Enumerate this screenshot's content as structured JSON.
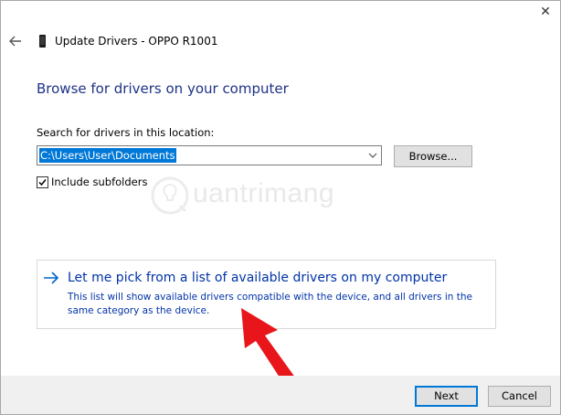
{
  "window": {
    "title": "Update Drivers - OPPO R1001",
    "close_glyph": "✕",
    "back_icon": "back-arrow-icon",
    "device_icon": "phone-icon"
  },
  "page": {
    "heading": "Browse for drivers on your computer",
    "search_label": "Search for drivers in this location:",
    "path_value": "C:\\Users\\User\\Documents",
    "browse_label": "Browse...",
    "include_subfolders_label": "Include subfolders",
    "include_subfolders_checked": true
  },
  "pick_option": {
    "title": "Let me pick from a list of available drivers on my computer",
    "description": "This list will show available drivers compatible with the device, and all drivers in the same category as the device."
  },
  "footer": {
    "next_label": "Next",
    "cancel_label": "Cancel"
  },
  "overlay": {
    "watermark_text": "uantrimang",
    "annotation_arrow_color": "#e8151b"
  },
  "colors": {
    "heading": "#1e3287",
    "link": "#0033a8",
    "selection": "#0078d7",
    "default_button_border": "#0078d7"
  }
}
